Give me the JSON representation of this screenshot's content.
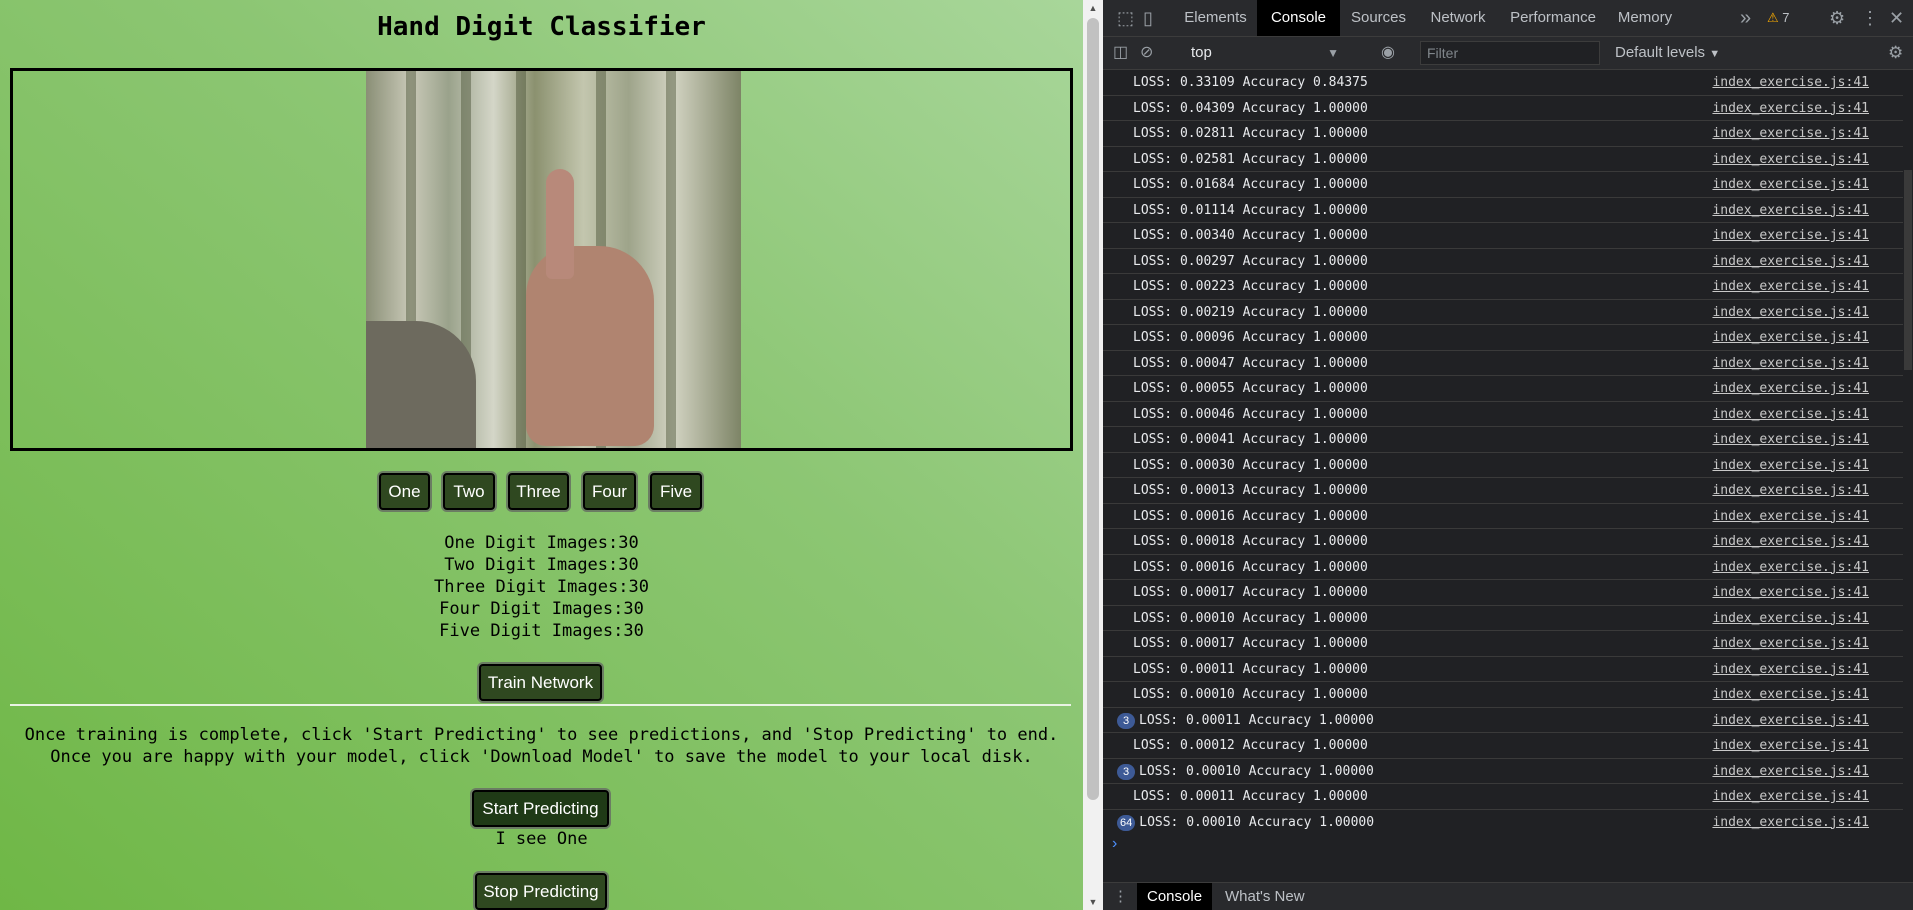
{
  "page": {
    "title": "Hand Digit Classifier",
    "digit_buttons": [
      "One",
      "Two",
      "Three",
      "Four",
      "Five"
    ],
    "counts": [
      "One Digit Images:30",
      "Two Digit Images:30",
      "Three Digit Images:30",
      "Four Digit Images:30",
      "Five Digit Images:30"
    ],
    "train_button": "Train Network",
    "instruction_line1": "Once training is complete, click 'Start Predicting' to see predictions, and 'Stop Predicting' to end.",
    "instruction_line2": "Once you are happy with your model, click 'Download Model' to save the model to your local disk.",
    "start_button": "Start Predicting",
    "prediction_text": "I see One",
    "stop_button": "Stop Predicting"
  },
  "devtools": {
    "tabs": [
      "Elements",
      "Console",
      "Sources",
      "Network",
      "Performance",
      "Memory"
    ],
    "active_tab": "Console",
    "warning_count": "7",
    "context": "top",
    "filter_placeholder": "Filter",
    "levels": "Default levels",
    "source": "index_exercise.js:41",
    "logs": [
      {
        "text": "LOSS: 0.33109 Accuracy 0.84375",
        "badge": ""
      },
      {
        "text": "LOSS: 0.04309 Accuracy 1.00000",
        "badge": ""
      },
      {
        "text": "LOSS: 0.02811 Accuracy 1.00000",
        "badge": ""
      },
      {
        "text": "LOSS: 0.02581 Accuracy 1.00000",
        "badge": ""
      },
      {
        "text": "LOSS: 0.01684 Accuracy 1.00000",
        "badge": ""
      },
      {
        "text": "LOSS: 0.01114 Accuracy 1.00000",
        "badge": ""
      },
      {
        "text": "LOSS: 0.00340 Accuracy 1.00000",
        "badge": ""
      },
      {
        "text": "LOSS: 0.00297 Accuracy 1.00000",
        "badge": ""
      },
      {
        "text": "LOSS: 0.00223 Accuracy 1.00000",
        "badge": ""
      },
      {
        "text": "LOSS: 0.00219 Accuracy 1.00000",
        "badge": ""
      },
      {
        "text": "LOSS: 0.00096 Accuracy 1.00000",
        "badge": ""
      },
      {
        "text": "LOSS: 0.00047 Accuracy 1.00000",
        "badge": ""
      },
      {
        "text": "LOSS: 0.00055 Accuracy 1.00000",
        "badge": ""
      },
      {
        "text": "LOSS: 0.00046 Accuracy 1.00000",
        "badge": ""
      },
      {
        "text": "LOSS: 0.00041 Accuracy 1.00000",
        "badge": ""
      },
      {
        "text": "LOSS: 0.00030 Accuracy 1.00000",
        "badge": ""
      },
      {
        "text": "LOSS: 0.00013 Accuracy 1.00000",
        "badge": ""
      },
      {
        "text": "LOSS: 0.00016 Accuracy 1.00000",
        "badge": ""
      },
      {
        "text": "LOSS: 0.00018 Accuracy 1.00000",
        "badge": ""
      },
      {
        "text": "LOSS: 0.00016 Accuracy 1.00000",
        "badge": ""
      },
      {
        "text": "LOSS: 0.00017 Accuracy 1.00000",
        "badge": ""
      },
      {
        "text": "LOSS: 0.00010 Accuracy 1.00000",
        "badge": ""
      },
      {
        "text": "LOSS: 0.00017 Accuracy 1.00000",
        "badge": ""
      },
      {
        "text": "LOSS: 0.00011 Accuracy 1.00000",
        "badge": ""
      },
      {
        "text": "LOSS: 0.00010 Accuracy 1.00000",
        "badge": ""
      },
      {
        "text": "LOSS: 0.00011 Accuracy 1.00000",
        "badge": "3"
      },
      {
        "text": "LOSS: 0.00012 Accuracy 1.00000",
        "badge": ""
      },
      {
        "text": "LOSS: 0.00010 Accuracy 1.00000",
        "badge": "3"
      },
      {
        "text": "LOSS: 0.00011 Accuracy 1.00000",
        "badge": ""
      },
      {
        "text": "LOSS: 0.00010 Accuracy 1.00000",
        "badge": "64"
      }
    ],
    "drawer_tabs": [
      "Console",
      "What's New"
    ]
  }
}
